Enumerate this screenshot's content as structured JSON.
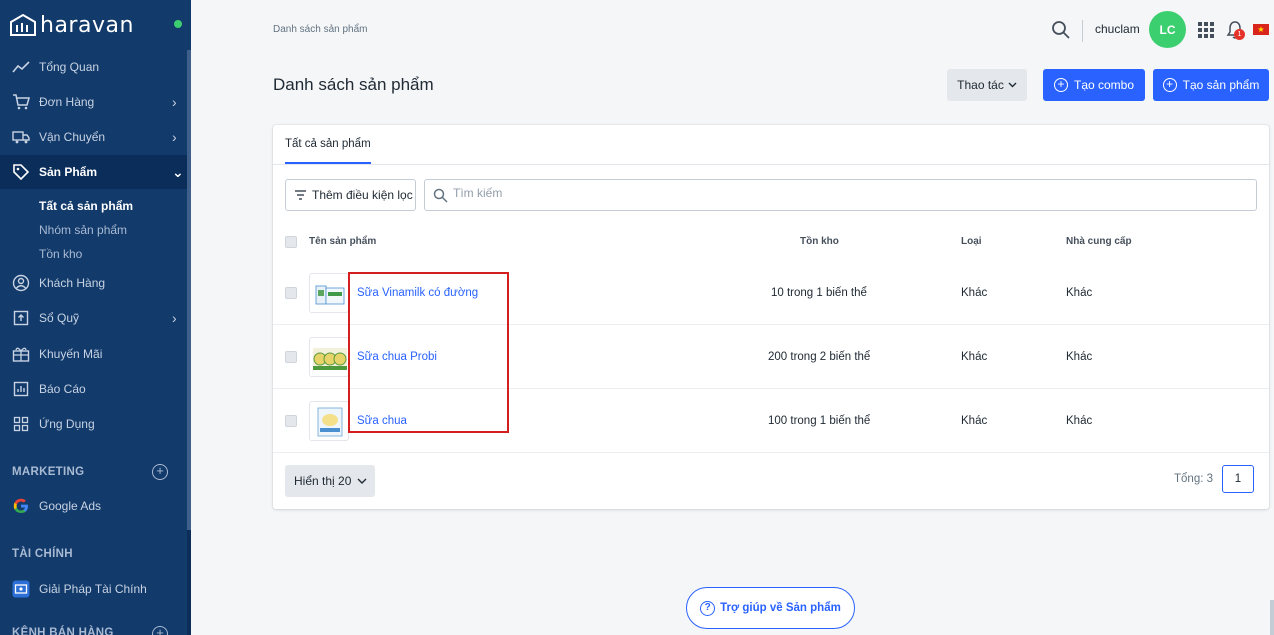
{
  "brand": {
    "name": "haravan"
  },
  "sidebar": {
    "items": [
      {
        "label": "Tổng Quan",
        "icon": "chart-line-icon"
      },
      {
        "label": "Đơn Hàng",
        "icon": "cart-icon"
      },
      {
        "label": "Vận Chuyển",
        "icon": "truck-icon"
      },
      {
        "label": "Sản Phẩm",
        "icon": "tag-icon"
      },
      {
        "label": "Khách Hàng",
        "icon": "user-circle-icon"
      },
      {
        "label": "Sổ Quỹ",
        "icon": "cashbook-icon"
      },
      {
        "label": "Khuyến Mãi",
        "icon": "gift-icon"
      },
      {
        "label": "Báo Cáo",
        "icon": "report-icon"
      },
      {
        "label": "Ứng Dụng",
        "icon": "apps-icon"
      }
    ],
    "sub_items": [
      "Tất cả sản phẩm",
      "Nhóm sản phẩm",
      "Tồn kho"
    ],
    "marketing": {
      "title": "MARKETING",
      "item": "Google Ads"
    },
    "finance": {
      "title": "TÀI CHÍNH",
      "item": "Giải Pháp Tài Chính"
    },
    "sales_channel": {
      "title": "KÊNH BÁN HÀNG"
    }
  },
  "header": {
    "breadcrumb": "Danh sách sản phẩm",
    "username": "chuclam",
    "avatar_initials": "LC",
    "notification_count": "1",
    "flag_star": "★"
  },
  "page": {
    "title": "Danh sách sản phẩm",
    "action_label": "Thao tác",
    "create_combo_label": "Tạo combo",
    "create_product_label": "Tạo sản phẩm"
  },
  "tabs": [
    "Tất cả sản phẩm"
  ],
  "filter": {
    "label": "Thêm điều kiện lọc",
    "search_placeholder": "Tìm kiếm"
  },
  "table": {
    "headers": {
      "name": "Tên sản phẩm",
      "stock": "Tồn kho",
      "type": "Loại",
      "vendor": "Nhà cung cấp"
    },
    "rows": [
      {
        "name": "Sữa Vinamilk có đường",
        "stock": "10 trong 1 biến thể",
        "type": "Khác",
        "vendor": "Khác"
      },
      {
        "name": "Sữa chua Probi",
        "stock": "200 trong 2 biến thể",
        "type": "Khác",
        "vendor": "Khác"
      },
      {
        "name": "Sữa chua",
        "stock": "100 trong 1 biến thể",
        "type": "Khác",
        "vendor": "Khác"
      }
    ]
  },
  "pagination": {
    "page_size_label": "Hiển thị 20",
    "total_label": "Tổng: 3",
    "current_page": "1"
  },
  "help": {
    "label": "Trợ giúp về Sản phẩm"
  },
  "colors": {
    "sidebar_bg": "#123a6b",
    "primary": "#2962ff",
    "avatar": "#3ccf70",
    "highlight": "#d41f1f"
  }
}
